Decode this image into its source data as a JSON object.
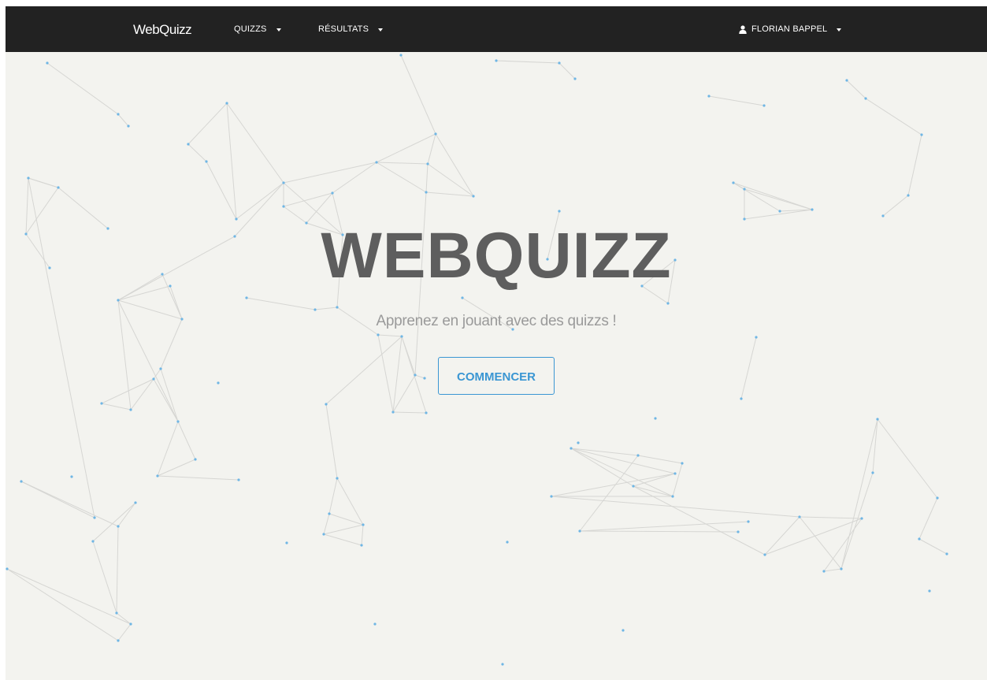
{
  "navbar": {
    "brand": "WebQuizz",
    "menu": [
      {
        "label": "QUIZZS"
      },
      {
        "label": "RÉSULTATS"
      }
    ],
    "user": {
      "name": "FLORIAN BAPPEL",
      "icon": "user-icon"
    }
  },
  "hero": {
    "title": "WEBQUIZZ",
    "subtitle": "Apprenez en jouant avec des quizzs !",
    "cta_label": "COMMENCER"
  },
  "colors": {
    "navbar_bg": "#222222",
    "page_bg": "#f3f3ef",
    "accent": "#3a96d3",
    "title": "#5e5e5e",
    "subtitle": "#9a9a9a",
    "node": "#6fb6e4",
    "edge": "#d8d8d8"
  }
}
